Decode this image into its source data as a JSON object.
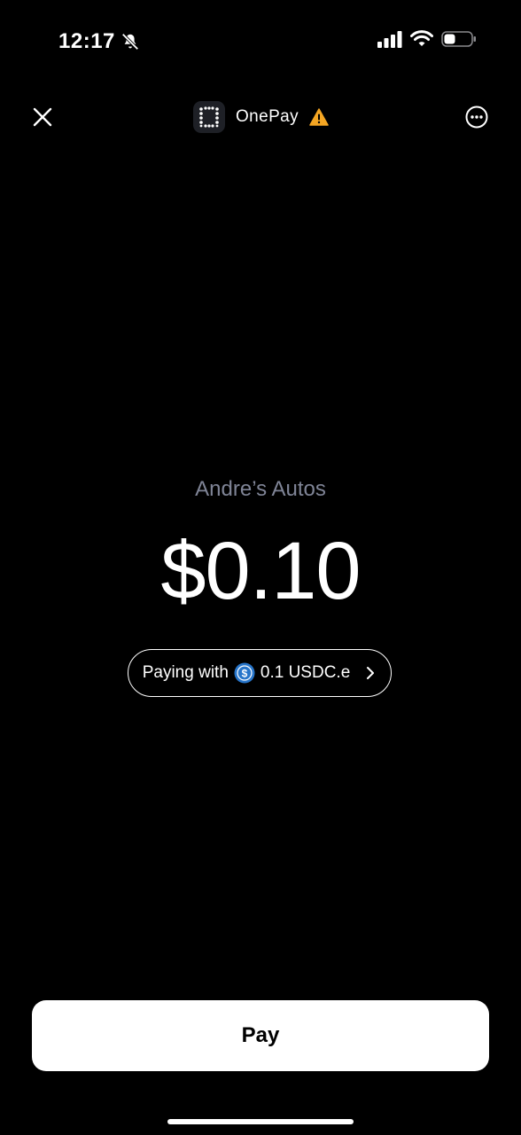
{
  "status_bar": {
    "time": "12:17",
    "icons": [
      "bell-slash-icon",
      "cellular-signal-icon",
      "wifi-icon",
      "battery-icon"
    ]
  },
  "header": {
    "app_name": "OnePay",
    "close_icon": "close-icon",
    "more_icon": "more-options-icon",
    "warning_icon": "warning-icon",
    "warning_color": "#f5a623"
  },
  "payment": {
    "merchant": "Andre’s Autos",
    "amount": "$0.10",
    "paying_with_label": "Paying with",
    "token_amount": "0.1 USDC.e",
    "token_icon": "usdc-coin-icon",
    "token_color": "#2775ca"
  },
  "actions": {
    "pay_label": "Pay"
  },
  "colors": {
    "background": "#000000",
    "merchant_text": "#7f8496",
    "button_bg": "#ffffff"
  }
}
